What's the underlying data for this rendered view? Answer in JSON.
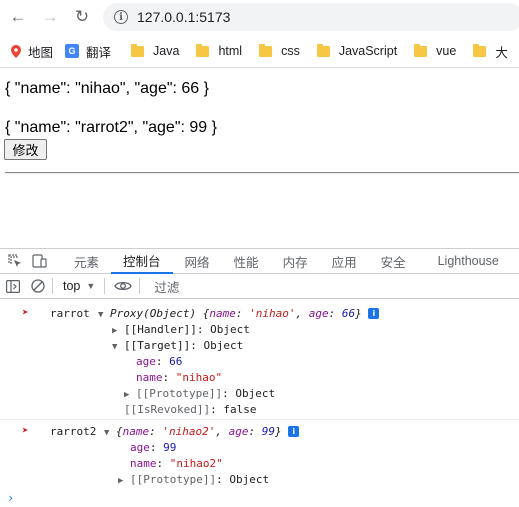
{
  "browser": {
    "url": "127.0.0.1:5173",
    "bookmarks": [
      {
        "label": "地图",
        "icon": "map-pin-icon"
      },
      {
        "label": "翻译",
        "icon": "google-translate-icon"
      },
      {
        "label": "Java",
        "icon": "folder-icon"
      },
      {
        "label": "html",
        "icon": "folder-icon"
      },
      {
        "label": "css",
        "icon": "folder-icon"
      },
      {
        "label": "JavaScript",
        "icon": "folder-icon"
      },
      {
        "label": "vue",
        "icon": "folder-icon"
      },
      {
        "label": "大",
        "icon": "folder-icon"
      }
    ]
  },
  "page": {
    "line1": "{ \"name\": \"nihao\", \"age\": 66 }",
    "line2": "{ \"name\": \"rarrot2\", \"age\": 99 }",
    "edit_button": "修改"
  },
  "devtools": {
    "tabs": [
      "元素",
      "控制台",
      "网络",
      "性能",
      "内存",
      "应用",
      "安全",
      "Lighthouse"
    ],
    "active_tab": "控制台",
    "context": "top",
    "filter_placeholder": "过滤",
    "colors": {
      "accent": "#1a73e8",
      "key": "#881391",
      "string": "#c41a16",
      "number": "#1a1aa6"
    }
  },
  "console": {
    "msg1": {
      "label": "rarrot",
      "summary_prefix": "Proxy(Object) {",
      "summary_name_key": "name",
      "summary_name_val": "'nihao'",
      "summary_age_key": "age",
      "summary_age_val": "66",
      "summary_suffix": "}",
      "handler": "[[Handler]]",
      "handler_val": "Object",
      "target": "[[Target]]",
      "target_val": "Object",
      "age_key": "age",
      "age_val": "66",
      "name_key": "name",
      "name_val": "\"nihao\"",
      "proto": "[[Prototype]]",
      "proto_val": "Object",
      "revoked": "[[IsRevoked]]",
      "revoked_val": "false"
    },
    "msg2": {
      "label": "rarrot2",
      "summary_prefix": "{",
      "summary_name_key": "name",
      "summary_name_val": "'nihao2'",
      "summary_age_key": "age",
      "summary_age_val": "99",
      "summary_suffix": "}",
      "age_key": "age",
      "age_val": "99",
      "name_key": "name",
      "name_val": "\"nihao2\"",
      "proto": "[[Prototype]]",
      "proto_val": "Object"
    },
    "info_badge": "i",
    "prompt": "›"
  }
}
